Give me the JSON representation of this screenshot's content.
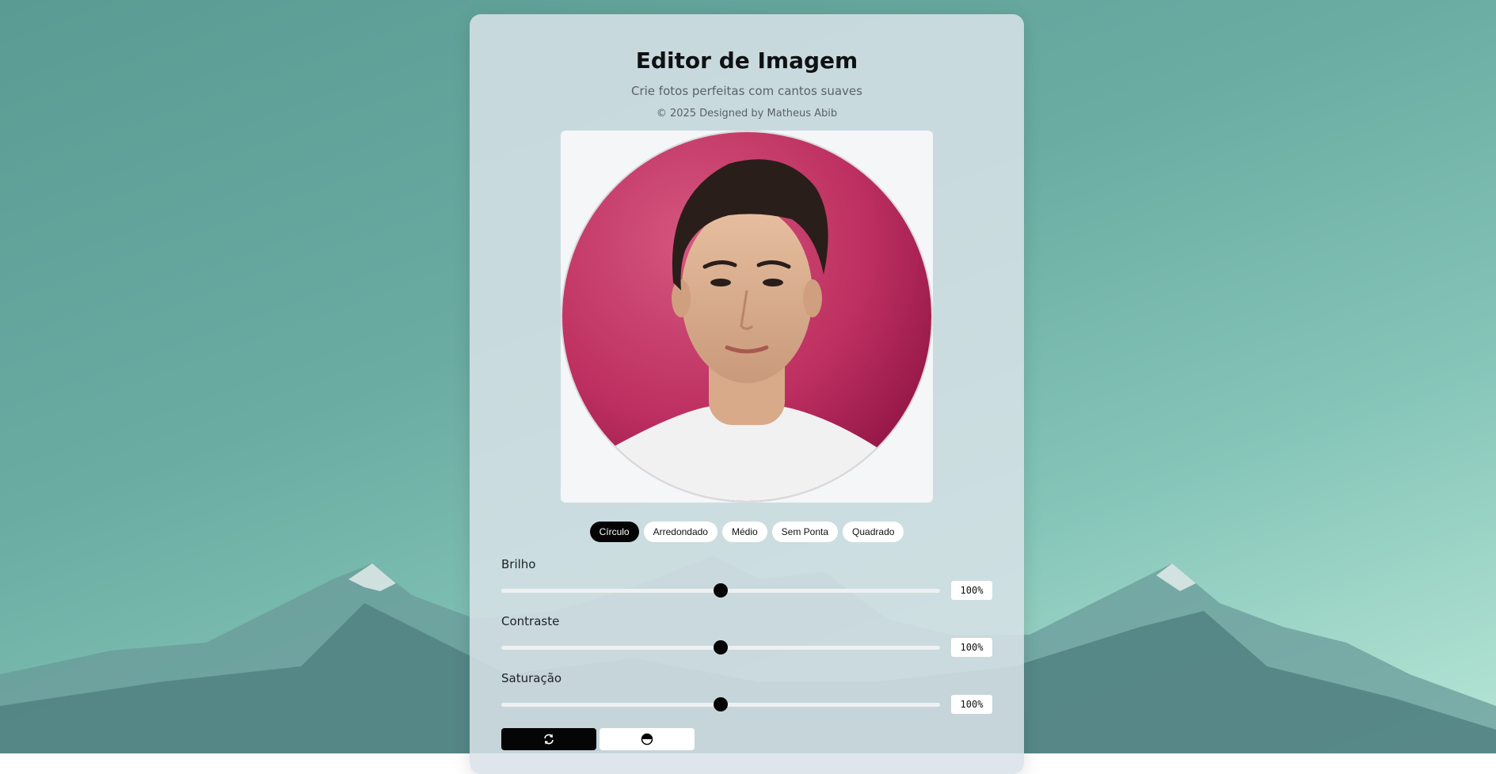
{
  "header": {
    "title": "Editor de Imagem",
    "subtitle": "Crie fotos perfeitas com cantos suaves",
    "credit": "© 2025 Designed by Matheus Abib"
  },
  "shape_options": [
    {
      "label": "Círculo",
      "active": true
    },
    {
      "label": "Arredondado",
      "active": false
    },
    {
      "label": "Médio",
      "active": false
    },
    {
      "label": "Sem Ponta",
      "active": false
    },
    {
      "label": "Quadrado",
      "active": false
    }
  ],
  "sliders": [
    {
      "label": "Brilho",
      "value": "100%",
      "position": 0.5
    },
    {
      "label": "Contraste",
      "value": "100%",
      "position": 0.5
    },
    {
      "label": "Saturação",
      "value": "100%",
      "position": 0.5
    }
  ],
  "actions": [
    {
      "icon": "refresh-icon",
      "style": "dark"
    },
    {
      "icon": "contrast-icon",
      "style": "light"
    }
  ],
  "colors": {
    "accent": "#050505",
    "photo_background": "#c23a6b"
  }
}
